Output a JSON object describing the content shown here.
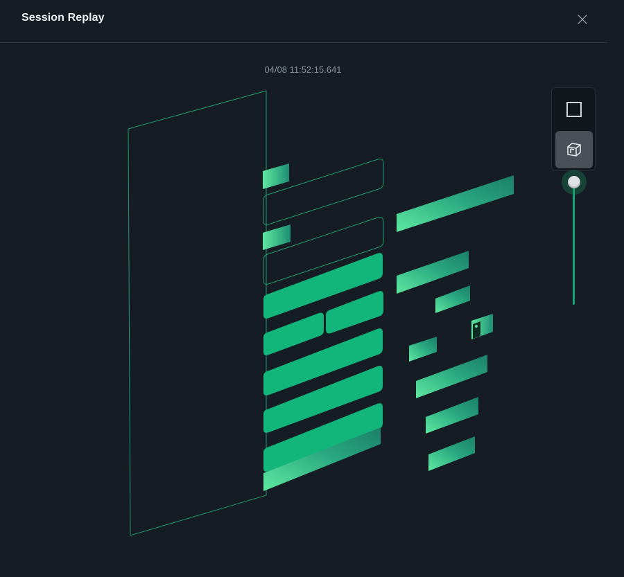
{
  "header": {
    "title": "Session Replay",
    "close_icon": "close-icon"
  },
  "replay": {
    "timestamp": "04/08 11:52:15.641"
  },
  "view_toolbar": {
    "flat_view_icon": "square-icon",
    "layers_view_icon": "cube-icon",
    "active_view": "layers"
  },
  "depth_slider": {
    "value": 1.0
  },
  "colors": {
    "background": "#161c23",
    "accent": "#12b57a",
    "accent_light": "#5ee8a0",
    "accent_dark": "#1a8a70",
    "outline": "#1f9e6e",
    "text_primary": "#eef1f4",
    "text_secondary": "#8a949e"
  }
}
